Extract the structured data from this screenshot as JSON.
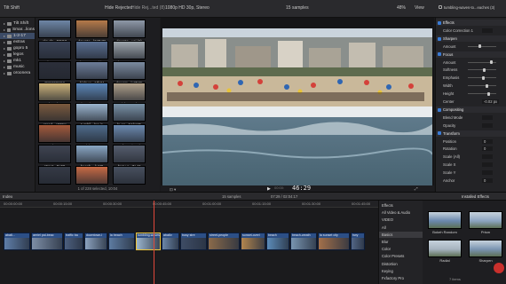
{
  "topbar": {
    "library_name": "Tilt Shift",
    "filter_label": "Hide Rejected",
    "browser_title": "Hide Rej...ted (8)",
    "format": "1080p HD 30p, Stereo",
    "sample_count": "15 samples",
    "zoom": "48%",
    "view_label": "View",
    "done_label": "Done",
    "inspector_title": "tumbling-waves-to...eaches (3)"
  },
  "library": {
    "items": [
      {
        "label": "Tilt Shift",
        "selected": false
      },
      {
        "label": "Smar...lions",
        "selected": false
      },
      {
        "label": "1-2-17",
        "selected": true
      },
      {
        "label": "extras",
        "selected": false
      },
      {
        "label": "gopro 5",
        "selected": false
      },
      {
        "label": "legos",
        "selected": false
      },
      {
        "label": "mk1",
        "selected": false
      },
      {
        "label": "music",
        "selected": false
      },
      {
        "label": "oroonera",
        "selected": false
      }
    ]
  },
  "browser": {
    "clips": [
      {
        "name": "clouds...EDOIt",
        "color": "#6e86a6"
      },
      {
        "name": "downto...kMD4R",
        "color": "#b57a4a"
      },
      {
        "name": "downto...usi (3)",
        "color": "#8e99a8"
      },
      {
        "name": "aba6...P1S",
        "color": "#3a4356"
      },
      {
        "name": "la-sun...Bwirin",
        "color": "#5a6f92"
      },
      {
        "name": "hwy-...YW6M",
        "color": "#9fa7ae"
      },
      {
        "name": "D9MGP6S7",
        "color": "#2c2f3a"
      },
      {
        "name": "highwa...MbZ4",
        "color": "#6d7d99"
      },
      {
        "name": "downto...kJZW5",
        "color": "#7c8ba0"
      },
      {
        "name": "Turtle...ulcNe6",
        "color": "#cbb27a"
      },
      {
        "name": "beach-...T4A",
        "color": "#5d87b8"
      },
      {
        "name": "arial...sW8h6",
        "color": "#b0a08a"
      },
      {
        "name": "grand...aDt2H",
        "color": "#7b5a3e"
      },
      {
        "name": "tumbli...log-is",
        "color": "#9cb6cf"
      },
      {
        "name": "la-co...Nnkg35",
        "color": "#7a92a8"
      },
      {
        "name": "speedy...Ktv-5",
        "color": "#a45a3c"
      },
      {
        "name": "malyb...MZW",
        "color": "#4f6c8c"
      },
      {
        "name": "surf-...ngiam-h",
        "color": "#6c8ab0"
      },
      {
        "name": "street...Ex68",
        "color": "#3f4452"
      },
      {
        "name": "beach-...k.M0",
        "color": "#8aa7c4"
      },
      {
        "name": "busy-c...Ze-M",
        "color": "#565e6e"
      },
      {
        "name": "",
        "color": "#353a46"
      },
      {
        "name": "",
        "color": "#c76a45"
      },
      {
        "name": "",
        "color": "#48505f"
      }
    ],
    "status": "1 of 228 selected, 10:04"
  },
  "viewer": {
    "timecode": "46:29",
    "timecode_prefix": "00:00:"
  },
  "inspector": {
    "rows": [
      {
        "label": "Effects",
        "type": "section"
      },
      {
        "label": "Color Correction 1",
        "type": "field"
      },
      {
        "label": "Sharpen",
        "type": "section"
      },
      {
        "label": "Amount",
        "type": "slider",
        "value": 0.4
      },
      {
        "label": "Focus",
        "type": "section"
      },
      {
        "label": "Amount",
        "type": "slider",
        "value": 0.85
      },
      {
        "label": "Softness",
        "type": "slider",
        "value": 0.6
      },
      {
        "label": "Emphasis",
        "type": "slider",
        "value": 0.55
      },
      {
        "label": "Width",
        "type": "slider",
        "value": 0.7
      },
      {
        "label": "Height",
        "type": "slider",
        "value": 0.75
      },
      {
        "label": "Center",
        "type": "value",
        "value": "-0.02 px"
      },
      {
        "label": "Compositing",
        "type": "section"
      },
      {
        "label": "Blend Mode",
        "type": "value",
        "value": ""
      },
      {
        "label": "Opacity",
        "type": "value",
        "value": ""
      },
      {
        "label": "Transform",
        "type": "section"
      },
      {
        "label": "Position",
        "type": "value",
        "value": "0"
      },
      {
        "label": "Rotation",
        "type": "value",
        "value": "0"
      },
      {
        "label": "Scale (All)",
        "type": "value",
        "value": ""
      },
      {
        "label": "Scale X",
        "type": "value",
        "value": ""
      },
      {
        "label": "Scale Y",
        "type": "value",
        "value": ""
      },
      {
        "label": "Anchor",
        "type": "value",
        "value": "0"
      }
    ]
  },
  "toolbar": {
    "index_label": "Index",
    "samples": "15 samples",
    "duration": "07:29 / 02:04:17",
    "effects_title": "Installed Effects"
  },
  "timeline": {
    "ticks": [
      "00:00:00:00",
      "00:00:15:00",
      "00:00:30:00",
      "00:00:45:00",
      "00:01:00:00",
      "00:01:15:00",
      "00:01:30:00",
      "00:01:45:00"
    ],
    "clips": [
      {
        "label": "aba6...",
        "color": "#5f7ea8"
      },
      {
        "label": "aeriel pal-beac",
        "color": "#7d8ea6"
      },
      {
        "label": "traffic ba",
        "color": "#4c5f7e"
      },
      {
        "label": "downtown-l",
        "color": "#8ba2be"
      },
      {
        "label": "la beach",
        "color": "#5d7ba1"
      },
      {
        "label": "tumbling-waves",
        "color": "#9ab4cc"
      },
      {
        "label": "aba6v",
        "color": "#6b86a8"
      },
      {
        "label": "busy stre",
        "color": "#3e4c65"
      },
      {
        "label": "street-people",
        "color": "#8a6a4a"
      },
      {
        "label": "sunset-overl",
        "color": "#b2854e"
      },
      {
        "label": "beach",
        "color": "#5b8bb8"
      },
      {
        "label": "beach-weath",
        "color": "#7894b0"
      },
      {
        "label": "la sunset city",
        "color": "#a3704a"
      },
      {
        "label": "hwy",
        "color": "#526685"
      }
    ]
  },
  "effects": {
    "categories": [
      {
        "label": "Effects",
        "selected": false
      },
      {
        "label": "All Video & Audio",
        "selected": false
      },
      {
        "label": "VIDEO",
        "selected": false
      },
      {
        "label": "All",
        "selected": false
      },
      {
        "label": "Basics",
        "selected": true
      },
      {
        "label": "Blur",
        "selected": false
      },
      {
        "label": "Color",
        "selected": false
      },
      {
        "label": "Color Presets",
        "selected": false
      },
      {
        "label": "Distortion",
        "selected": false
      },
      {
        "label": "Keying",
        "selected": false
      },
      {
        "label": "Fxfactory Pro",
        "selected": false
      }
    ],
    "tiles": [
      {
        "name": "Bokeh Random",
        "color": "#6a88ad"
      },
      {
        "name": "Prism",
        "color": "#8ca4c0"
      },
      {
        "name": "Radial",
        "color": "#a6b3bf"
      },
      {
        "name": "Sharpen",
        "color": "#7a94b1"
      }
    ],
    "footer": "7 items"
  }
}
